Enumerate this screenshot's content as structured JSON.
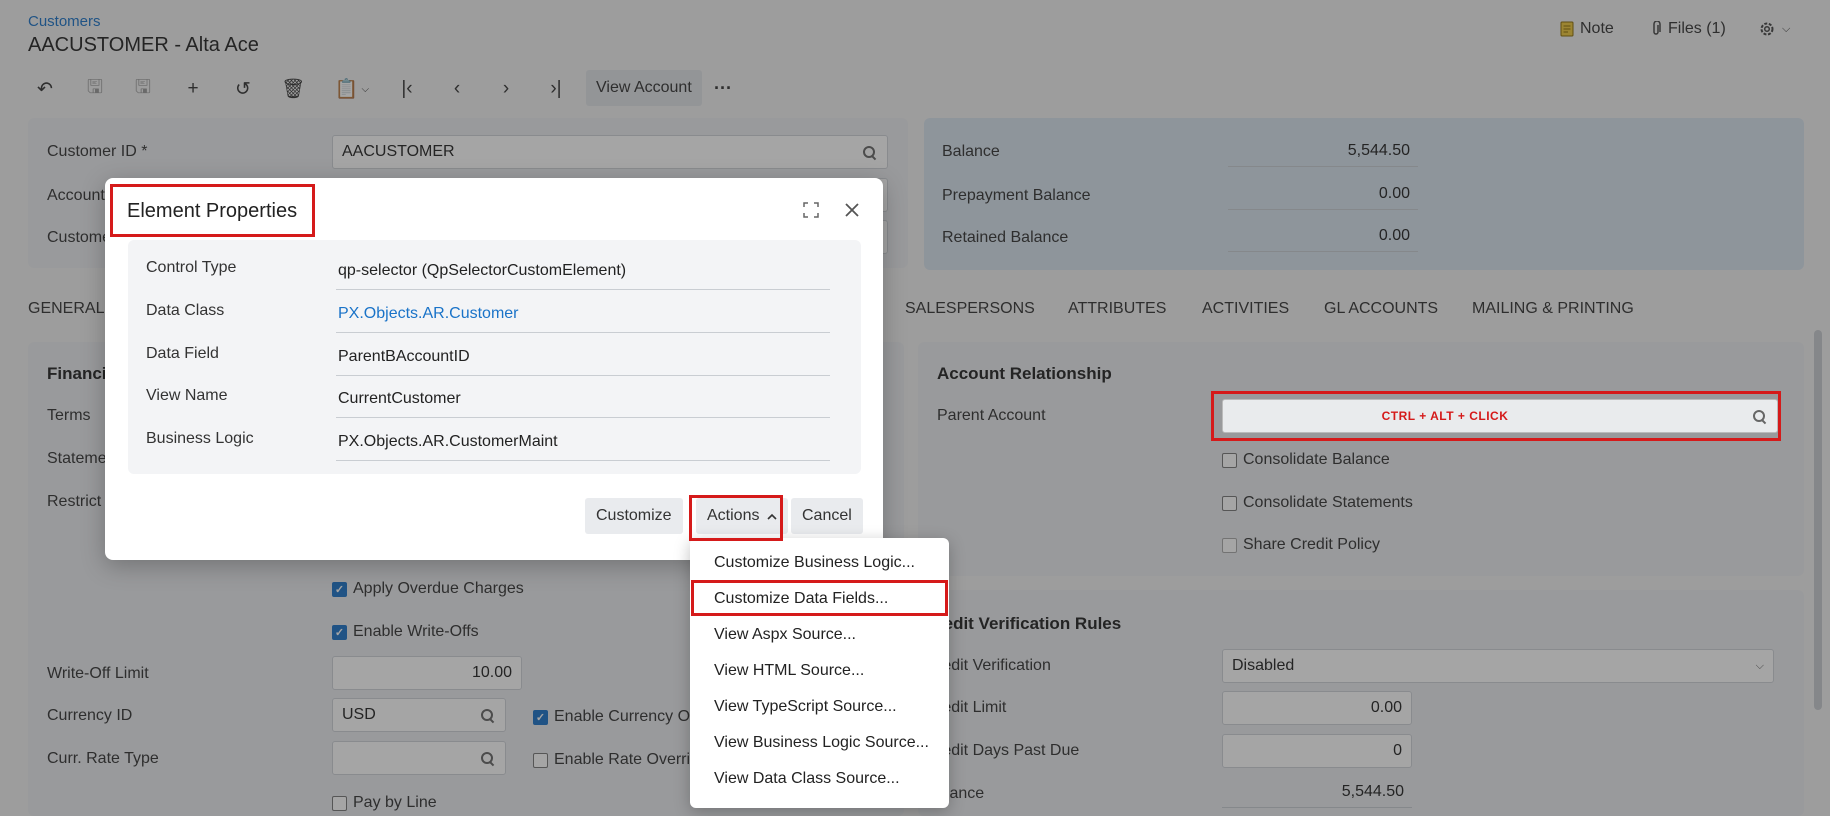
{
  "header": {
    "breadcrumb": "Customers",
    "title": "AACUSTOMER - Alta Ace",
    "note_label": "Note",
    "files_label": "Files (1)"
  },
  "toolbar": {
    "view_account_label": "View Account",
    "more_label": "···"
  },
  "summary": {
    "customer_id_label": "Customer ID *",
    "customer_id_value": "AACUSTOMER",
    "account_label": "Account",
    "customer_label": "Custome",
    "balance_label": "Balance",
    "balance_value": "5,544.50",
    "prepayment_label": "Prepayment Balance",
    "prepayment_value": "0.00",
    "retained_label": "Retained Balance",
    "retained_value": "0.00"
  },
  "tabs": {
    "general": "GENERAL",
    "salespersons": "SALESPERSONS",
    "attributes": "ATTRIBUTES",
    "activities": "ACTIVITIES",
    "gl_accounts": "GL ACCOUNTS",
    "mailing": "MAILING & PRINTING"
  },
  "financial": {
    "title": "Financi",
    "terms_label": "Terms",
    "statement_label": "Stateme",
    "restrict_label": "Restrict",
    "apply_overdue_label": "Apply Overdue Charges",
    "enable_writeoffs_label": "Enable Write-Offs",
    "writeoff_limit_label": "Write-Off Limit",
    "writeoff_limit_value": "10.00",
    "currency_id_label": "Currency ID",
    "currency_id_value": "USD",
    "enable_currency_label": "Enable Currency O",
    "curr_rate_type_label": "Curr. Rate Type",
    "enable_rate_label": "Enable Rate Overri",
    "pay_by_line_label": "Pay by Line"
  },
  "account_relationship": {
    "title": "Account Relationship",
    "parent_account_label": "Parent Account",
    "parent_hint": "CTRL + ALT + CLICK",
    "consolidate_balance_label": "Consolidate Balance",
    "consolidate_statements_label": "Consolidate Statements",
    "share_credit_label": "Share Credit Policy"
  },
  "credit": {
    "title": "redit Verification Rules",
    "verification_label": "redit Verification",
    "verification_value": "Disabled",
    "limit_label": "redit Limit",
    "limit_value": "0.00",
    "days_label": "redit Days Past Due",
    "days_value": "0",
    "balance_label": "alance",
    "balance_value": "5,544.50"
  },
  "dialog": {
    "title": "Element Properties",
    "control_type_label": "Control Type",
    "control_type_value": "qp-selector (QpSelectorCustomElement)",
    "data_class_label": "Data Class",
    "data_class_value": "PX.Objects.AR.Customer",
    "data_field_label": "Data Field",
    "data_field_value": "ParentBAccountID",
    "view_name_label": "View Name",
    "view_name_value": "CurrentCustomer",
    "business_logic_label": "Business Logic",
    "business_logic_value": "PX.Objects.AR.CustomerMaint",
    "customize_label": "Customize",
    "actions_label": "Actions",
    "cancel_label": "Cancel"
  },
  "actions_menu": {
    "items": [
      "Customize Business Logic...",
      "Customize Data Fields...",
      "View Aspx Source...",
      "View HTML Source...",
      "View TypeScript Source...",
      "View Business Logic Source...",
      "View Data Class Source..."
    ]
  },
  "colors": {
    "accent": "#1a73c8",
    "highlight": "#d51a1a"
  }
}
